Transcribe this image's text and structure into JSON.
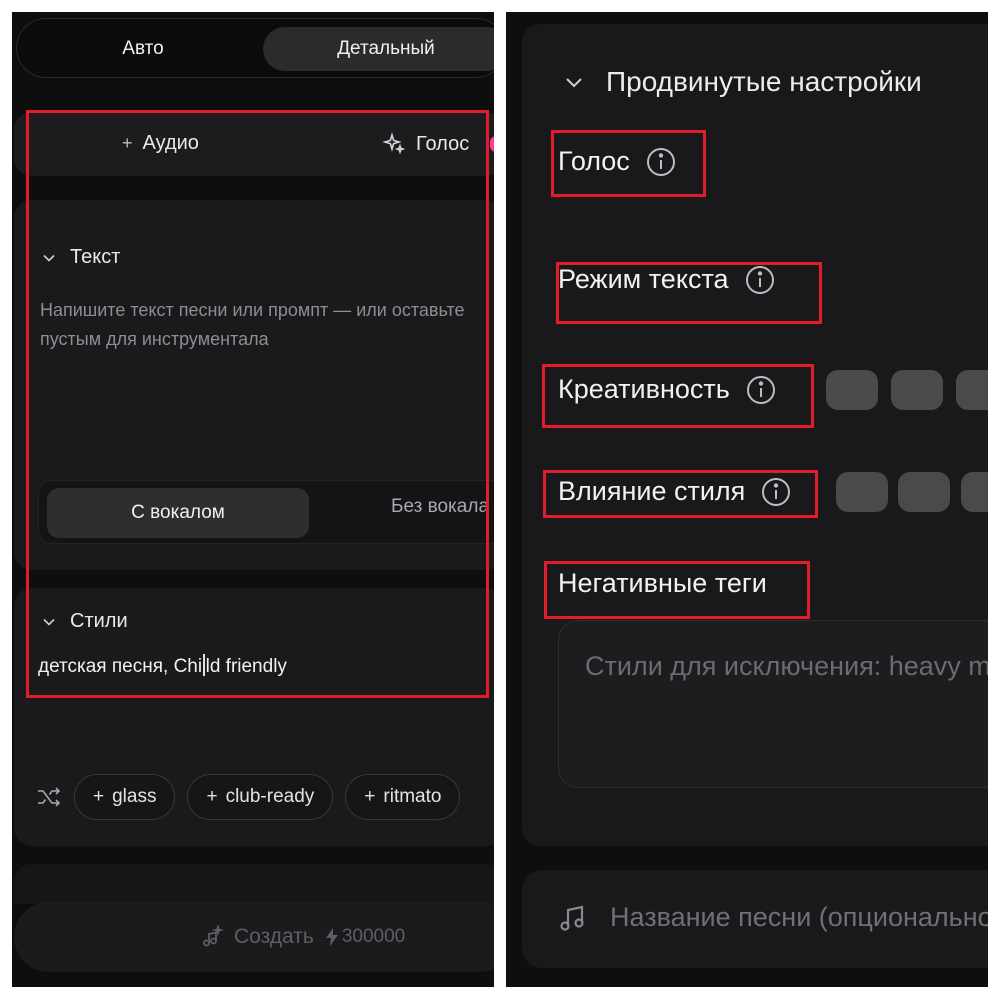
{
  "left": {
    "mode_switch": {
      "auto_label": "Авто",
      "detailed_label": "Детальный"
    },
    "audio_row": {
      "add_audio_label": "Аудио",
      "voice_label": "Голос"
    },
    "lyrics": {
      "title": "Текст",
      "placeholder": "Напишите текст песни или промпт — или оставьте пустым для инструментала",
      "with_vocal_label": "С вокалом",
      "without_vocal_label": "Без вокала"
    },
    "styles": {
      "title": "Стили",
      "value_before_caret": "детская песня, Chi",
      "value_after_caret": "ld friendly",
      "suggested_tags": [
        "glass",
        "club-ready",
        "ritmato"
      ]
    },
    "create": {
      "label": "Создать",
      "credits": "300000"
    }
  },
  "right": {
    "advanced": {
      "title": "Продвинутые настройки",
      "params": {
        "voice": "Голос",
        "lyrics_mode": "Режим текста",
        "creativity": "Креативность",
        "style_influence": "Влияние стиля",
        "negative_tags": "Негативные теги"
      },
      "negative_placeholder": "Стили для исключения: heavy metal"
    },
    "song_title_placeholder": "Название песни (опционально)"
  },
  "colors": {
    "background": "#0e0e0f",
    "card": "#1a1a1c",
    "highlight_frame": "#e11d2b",
    "voice_dot": "#ff3d98"
  }
}
